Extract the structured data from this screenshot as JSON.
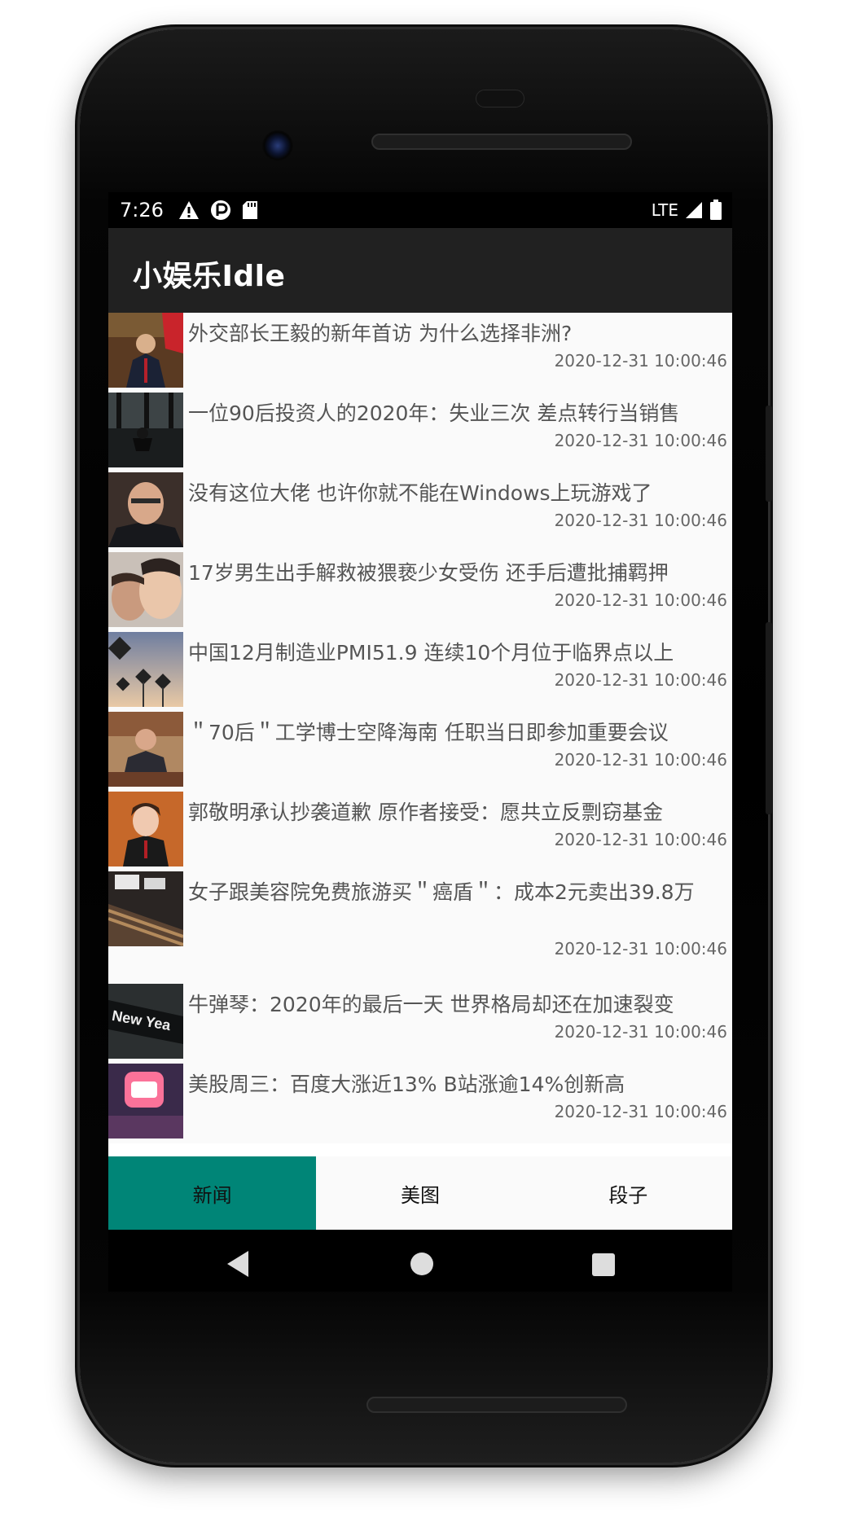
{
  "status_bar": {
    "time": "7:26",
    "left_icons": [
      "warning-icon",
      "data-saver-icon",
      "sd-card-icon"
    ],
    "network_label": "LTE",
    "right_icons": [
      "signal-icon",
      "battery-icon"
    ]
  },
  "app_bar": {
    "title": "小娱乐Idle"
  },
  "news": [
    {
      "title": "外交部长王毅的新年首访 为什么选择非洲?",
      "time": "2020-12-31 10:00:46",
      "thumb": "thumb-image"
    },
    {
      "title": "一位90后投资人的2020年：失业三次 差点转行当销售",
      "time": "2020-12-31 10:00:46",
      "thumb": "thumb-image"
    },
    {
      "title": "没有这位大佬 也许你就不能在Windows上玩游戏了",
      "time": "2020-12-31 10:00:46",
      "thumb": "thumb-image"
    },
    {
      "title": "17岁男生出手解救被猥亵少女受伤 还手后遭批捕羁押",
      "time": "2020-12-31 10:00:46",
      "thumb": "thumb-image"
    },
    {
      "title": "中国12月制造业PMI51.9 连续10个月位于临界点以上",
      "time": "2020-12-31 10:00:46",
      "thumb": "thumb-image"
    },
    {
      "title": "＂70后＂工学博士空降海南 任职当日即参加重要会议",
      "time": "2020-12-31 10:00:46",
      "thumb": "thumb-image"
    },
    {
      "title": "郭敬明承认抄袭道歉 原作者接受：愿共立反剽窃基金",
      "time": "2020-12-31 10:00:46",
      "thumb": "thumb-image"
    },
    {
      "title": "女子跟美容院免费旅游买＂癌盾＂：成本2元卖出39.8万",
      "time": "2020-12-31 10:00:46",
      "thumb": "thumb-image"
    },
    {
      "title": "牛弹琴：2020年的最后一天 世界格局却还在加速裂变",
      "time": "2020-12-31 10:00:46",
      "thumb": "thumb-image"
    },
    {
      "title": "美股周三：百度大涨近13% B站涨逾14%创新高",
      "time": "2020-12-31 10:00:46",
      "thumb": "thumb-image"
    }
  ],
  "tabs": [
    {
      "label": "新闻",
      "active": true
    },
    {
      "label": "美图",
      "active": false
    },
    {
      "label": "段子",
      "active": false
    }
  ],
  "colors": {
    "app_bar": "#212121",
    "tab_active": "#008577",
    "list_bg": "#fafafa"
  }
}
